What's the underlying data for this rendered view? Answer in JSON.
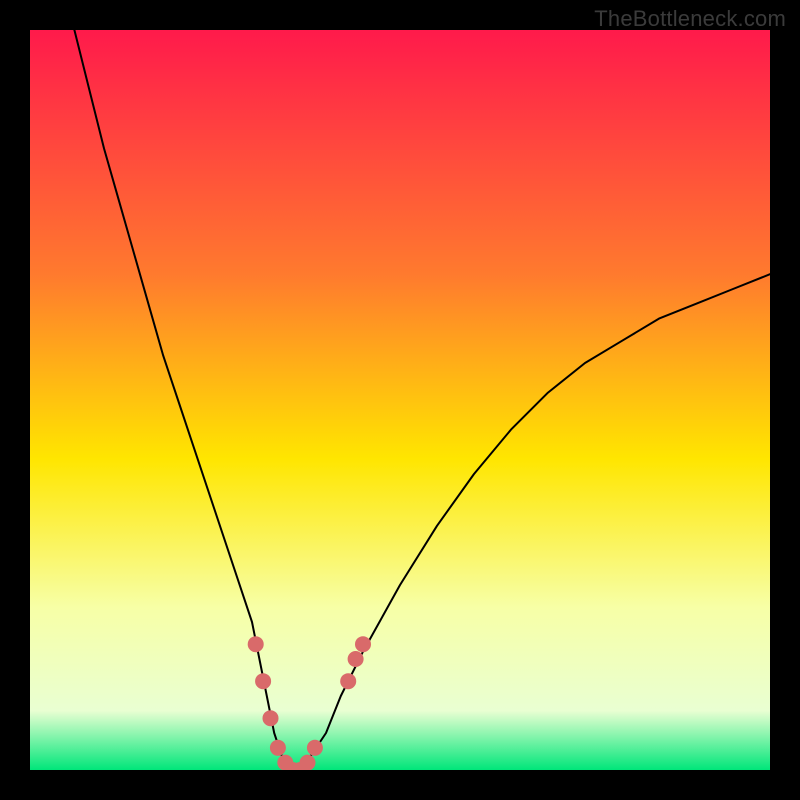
{
  "watermark": "TheBottleneck.com",
  "chart_data": {
    "type": "line",
    "title": "",
    "xlabel": "",
    "ylabel": "",
    "xlim": [
      0,
      100
    ],
    "ylim": [
      0,
      100
    ],
    "grid": false,
    "background_gradient": {
      "direction": "vertical",
      "stops": [
        {
          "offset": 0.0,
          "color": "#ff1a4b"
        },
        {
          "offset": 0.33,
          "color": "#ff7a2e"
        },
        {
          "offset": 0.58,
          "color": "#ffe600"
        },
        {
          "offset": 0.78,
          "color": "#f7ffa6"
        },
        {
          "offset": 0.92,
          "color": "#e9ffd2"
        },
        {
          "offset": 1.0,
          "color": "#00e67a"
        }
      ]
    },
    "series": [
      {
        "name": "bottleneck-curve",
        "stroke": "#000000",
        "stroke_width": 2,
        "x": [
          6,
          8,
          10,
          12,
          14,
          16,
          18,
          20,
          22,
          24,
          26,
          28,
          30,
          31,
          32,
          33,
          34,
          35,
          36,
          37,
          38,
          40,
          42,
          45,
          50,
          55,
          60,
          65,
          70,
          75,
          80,
          85,
          90,
          95,
          100
        ],
        "y": [
          100,
          92,
          84,
          77,
          70,
          63,
          56,
          50,
          44,
          38,
          32,
          26,
          20,
          15,
          10,
          5,
          2,
          0,
          0,
          0,
          2,
          5,
          10,
          16,
          25,
          33,
          40,
          46,
          51,
          55,
          58,
          61,
          63,
          65,
          67
        ]
      }
    ],
    "highlight_points": {
      "color": "#d96a6a",
      "radius": 8,
      "points": [
        {
          "x": 30.5,
          "y": 17
        },
        {
          "x": 31.5,
          "y": 12
        },
        {
          "x": 32.5,
          "y": 7
        },
        {
          "x": 33.5,
          "y": 3
        },
        {
          "x": 34.5,
          "y": 1
        },
        {
          "x": 35.5,
          "y": 0
        },
        {
          "x": 36.5,
          "y": 0
        },
        {
          "x": 37.5,
          "y": 1
        },
        {
          "x": 38.5,
          "y": 3
        },
        {
          "x": 43,
          "y": 12
        },
        {
          "x": 44,
          "y": 15
        },
        {
          "x": 45,
          "y": 17
        }
      ]
    }
  }
}
